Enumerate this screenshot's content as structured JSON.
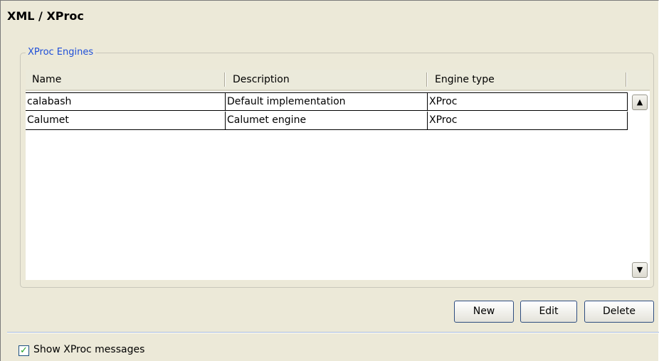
{
  "page": {
    "title": "XML / XProc"
  },
  "engines_group": {
    "legend": "XProc Engines",
    "columns": [
      "Name",
      "Description",
      "Engine type"
    ],
    "rows": [
      {
        "name": "calabash",
        "description": "Default implementation",
        "engine_type": "XProc"
      },
      {
        "name": "Calumet",
        "description": "Calumet engine",
        "engine_type": "XProc"
      }
    ],
    "scroll_up_icon": "chevron-up-icon",
    "scroll_down_icon": "chevron-down-icon"
  },
  "buttons": {
    "new_label": "New",
    "edit_label": "Edit",
    "delete_label": "Delete"
  },
  "options": {
    "show_messages_label": "Show XProc messages",
    "show_messages_checked": true
  },
  "colors": {
    "legend_text": "#1f4fd8",
    "checkmark": "#21a121",
    "panel_bg": "#ece9d8"
  }
}
